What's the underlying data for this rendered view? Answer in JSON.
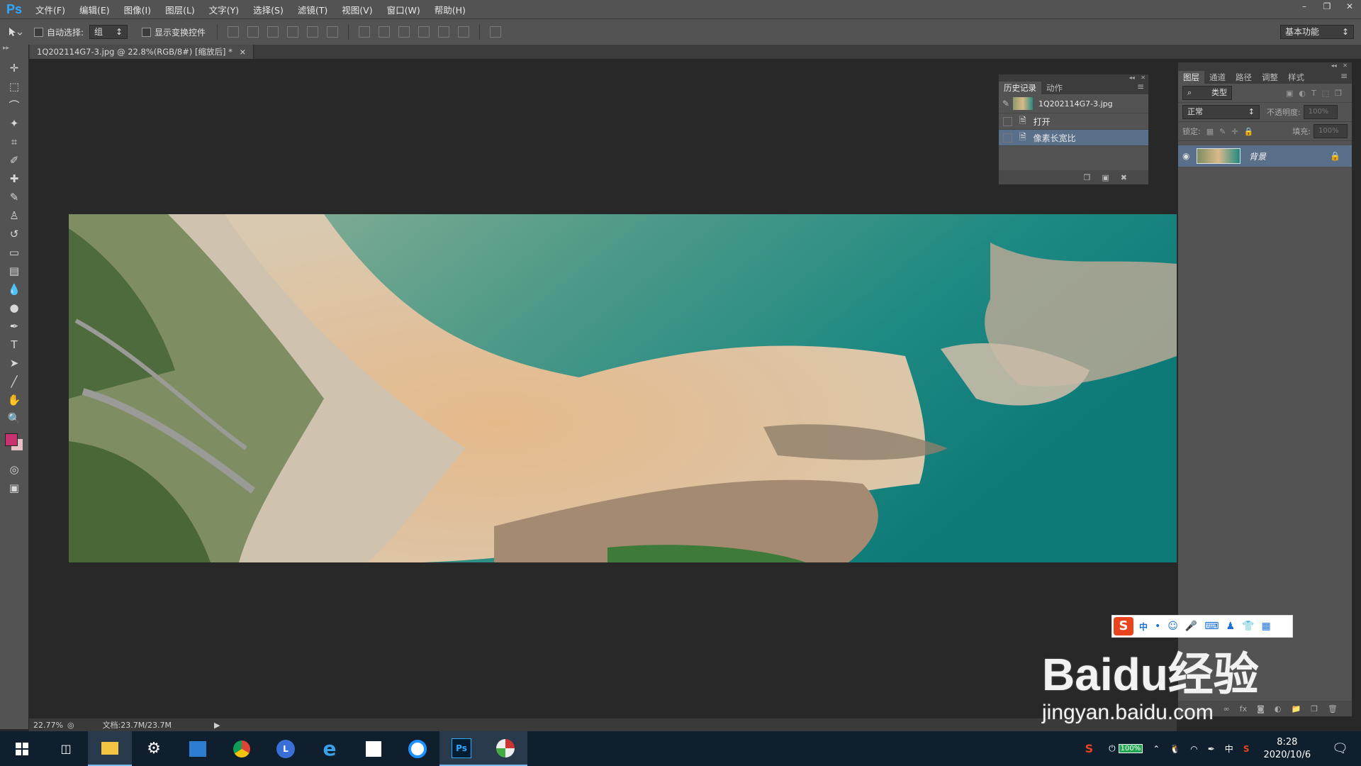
{
  "app": {
    "logo": "Ps"
  },
  "menu": [
    "文件(F)",
    "编辑(E)",
    "图像(I)",
    "图层(L)",
    "文字(Y)",
    "选择(S)",
    "滤镜(T)",
    "视图(V)",
    "窗口(W)",
    "帮助(H)"
  ],
  "options_bar": {
    "auto_select_label": "自动选择:",
    "auto_select_value": "组",
    "show_transform_label": "显示变换控件",
    "workspace": "基本功能"
  },
  "document_tab": {
    "title": "1Q202114G7-3.jpg @ 22.8%(RGB/8#) [缩放后] *",
    "close": "×"
  },
  "history_panel": {
    "tabs": [
      "历史记录",
      "动作"
    ],
    "snapshot": "1Q202114G7-3.jpg",
    "items": [
      "打开",
      "像素长宽比"
    ]
  },
  "layers_panel": {
    "tabs": [
      "图层",
      "通道",
      "路径",
      "调整",
      "样式"
    ],
    "filter_kind": "类型",
    "blend_mode": "正常",
    "opacity_label": "不透明度:",
    "opacity_value": "100%",
    "lock_label": "锁定:",
    "fill_label": "填充:",
    "fill_value": "100%",
    "layer_name": "背景"
  },
  "status_bar": {
    "zoom": "22.77%",
    "doc": "文档:23.7M/23.7M"
  },
  "taskbar": {
    "battery": "100%",
    "ime_lang": "中",
    "time": "8:28",
    "date": "2020/10/6"
  },
  "ime_toolbar": {
    "lang": "中"
  },
  "watermark": {
    "line1": "Baidu经验",
    "line2": "jingyan.baidu.com"
  },
  "colors": {
    "foreground": "#c8326e",
    "background": "#e8c0c8",
    "accent": "#31a8ff"
  }
}
